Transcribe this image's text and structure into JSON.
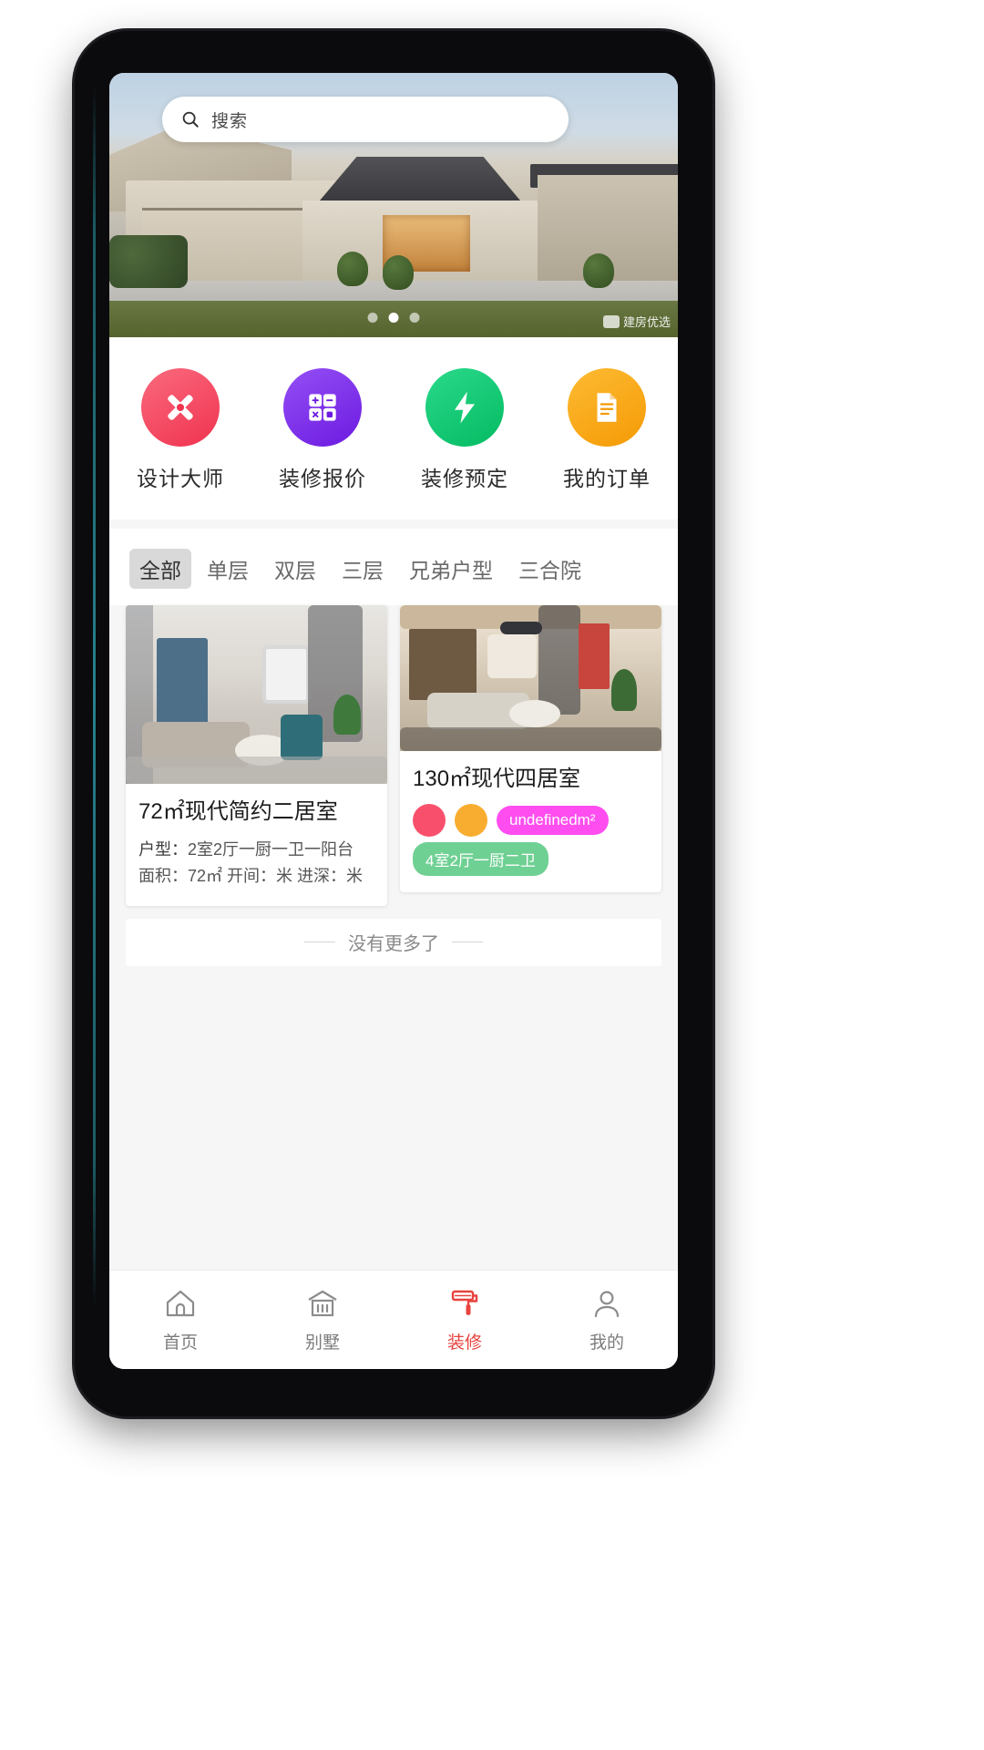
{
  "app": {
    "name": "装修 App 首页",
    "accent_color": "#e8433f"
  },
  "hero": {
    "search": {
      "placeholder": "搜索",
      "value": "",
      "icon": "search-icon"
    },
    "carousel": {
      "total_dots": 3,
      "active_index": 1
    },
    "watermark": "建房优选"
  },
  "quick_actions": [
    {
      "label": "设计大师",
      "icon": "design-tools-icon",
      "color": "#f9566e",
      "color2": "#f2334f"
    },
    {
      "label": "装修报价",
      "icon": "calculator-icon",
      "color": "#8a3df0",
      "color2": "#6f1fe0"
    },
    {
      "label": "装修预定",
      "icon": "lightning-icon",
      "color": "#22cf7a",
      "color2": "#07bf66"
    },
    {
      "label": "我的订单",
      "icon": "document-icon",
      "color": "#fbad1d",
      "color2": "#f59a05"
    }
  ],
  "tabs": {
    "active": "全部",
    "items": [
      "全部",
      "单层",
      "双层",
      "三层",
      "兄弟户型",
      "三合院"
    ]
  },
  "cards": [
    {
      "title": "72㎡现代简约二居室",
      "layout_label": "户型：",
      "layout_value": "2室2厅一厨一卫一阳台",
      "area_line": "面积：72㎡ 开间：米 进深：米",
      "chips": [],
      "dots": []
    },
    {
      "title": "130㎡现代四居室",
      "layout_label": "",
      "layout_value": "",
      "area_line": "",
      "dots": [
        {
          "color": "#f8506c"
        },
        {
          "color": "#f9ad30"
        }
      ],
      "chips": [
        {
          "text": "undefinedm²",
          "color": "#ff4df0"
        },
        {
          "text": "4室2厅一厨二卫",
          "color": "#6fd093"
        }
      ]
    }
  ],
  "footer": {
    "no_more_text": "没有更多了"
  },
  "bottom_nav": {
    "active": "装修",
    "items": [
      {
        "label": "首页",
        "icon": "home-icon"
      },
      {
        "label": "别墅",
        "icon": "villa-icon"
      },
      {
        "label": "装修",
        "icon": "paint-roller-icon"
      },
      {
        "label": "我的",
        "icon": "person-icon"
      }
    ]
  }
}
